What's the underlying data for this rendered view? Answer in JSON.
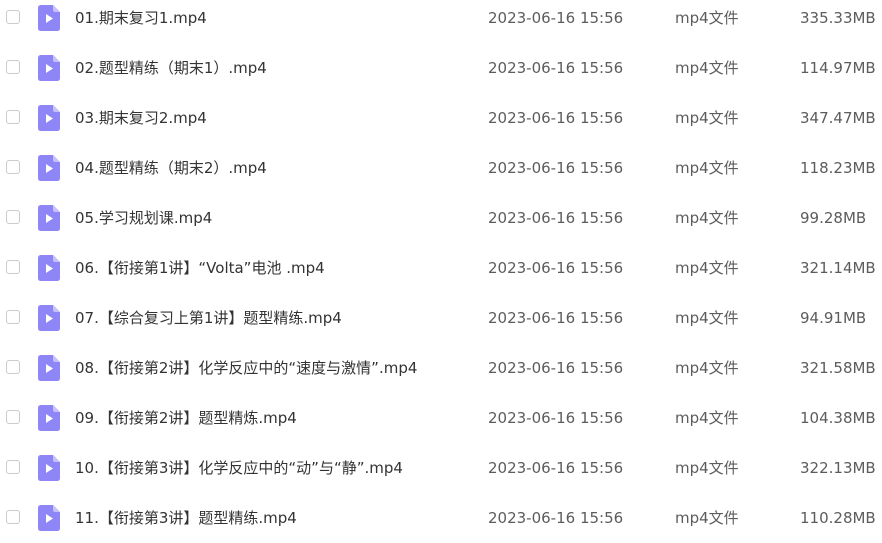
{
  "file_icon": "video-file-icon",
  "accent_color": "#7b6ef6",
  "files": [
    {
      "name": "01.期末复习1.mp4",
      "date": "2023-06-16 15:56",
      "type": "mp4文件",
      "size": "335.33MB"
    },
    {
      "name": "02.题型精练（期末1）.mp4",
      "date": "2023-06-16 15:56",
      "type": "mp4文件",
      "size": "114.97MB"
    },
    {
      "name": "03.期末复习2.mp4",
      "date": "2023-06-16 15:56",
      "type": "mp4文件",
      "size": "347.47MB"
    },
    {
      "name": "04.题型精练（期末2）.mp4",
      "date": "2023-06-16 15:56",
      "type": "mp4文件",
      "size": "118.23MB"
    },
    {
      "name": "05.学习规划课.mp4",
      "date": "2023-06-16 15:56",
      "type": "mp4文件",
      "size": "99.28MB"
    },
    {
      "name": "06.【衔接第1讲】“Volta”电池 .mp4",
      "date": "2023-06-16 15:56",
      "type": "mp4文件",
      "size": "321.14MB"
    },
    {
      "name": "07.【综合复习上第1讲】题型精练.mp4",
      "date": "2023-06-16 15:56",
      "type": "mp4文件",
      "size": "94.91MB"
    },
    {
      "name": "08.【衔接第2讲】化学反应中的“速度与激情”.mp4",
      "date": "2023-06-16 15:56",
      "type": "mp4文件",
      "size": "321.58MB"
    },
    {
      "name": "09.【衔接第2讲】题型精炼.mp4",
      "date": "2023-06-16 15:56",
      "type": "mp4文件",
      "size": "104.38MB"
    },
    {
      "name": "10.【衔接第3讲】化学反应中的“动”与“静”.mp4",
      "date": "2023-06-16 15:56",
      "type": "mp4文件",
      "size": "322.13MB"
    },
    {
      "name": "11.【衔接第3讲】题型精练.mp4",
      "date": "2023-06-16 15:56",
      "type": "mp4文件",
      "size": "110.28MB"
    }
  ]
}
